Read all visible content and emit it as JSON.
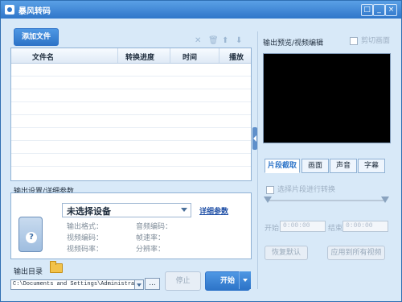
{
  "window": {
    "title": "暴风转码",
    "controls": [
      "□",
      "_",
      "×"
    ]
  },
  "toolbar": {
    "add_file": "添加文件",
    "icons": [
      "close-icon",
      "trash-icon",
      "move-up-icon",
      "move-down-icon"
    ]
  },
  "file_table": {
    "columns": [
      "文件名",
      "转换进度",
      "时间",
      "播放"
    ]
  },
  "output_settings": {
    "section_label": "输出设置/详细参数",
    "device_select": "未选择设备",
    "detail_link": "详细参数",
    "left_fields": [
      "输出格式：",
      "视频编码：",
      "视频码率："
    ],
    "right_fields": [
      "音频编码：",
      "帧速率：",
      "分辨率："
    ]
  },
  "output_dir": {
    "label": "输出目录",
    "path": "C:\\Documents and Settings\\Administra",
    "browse": "..."
  },
  "actions": {
    "stop": "停止",
    "start": "开始"
  },
  "preview": {
    "title": "输出预览/视频编辑",
    "crop_checkbox": "剪切画面",
    "tabs": [
      "片段截取",
      "画面",
      "声音",
      "字幕"
    ],
    "segment_checkbox": "选择片段进行转换",
    "start_label": "开始",
    "end_label": "结束",
    "start_time": "0:00:00",
    "end_time": "0:00:00",
    "restore_default": "恢复默认",
    "apply_all": "应用到所有视频"
  },
  "colors": {
    "accent": "#2f76c9",
    "frame": "#d8e9f8"
  }
}
